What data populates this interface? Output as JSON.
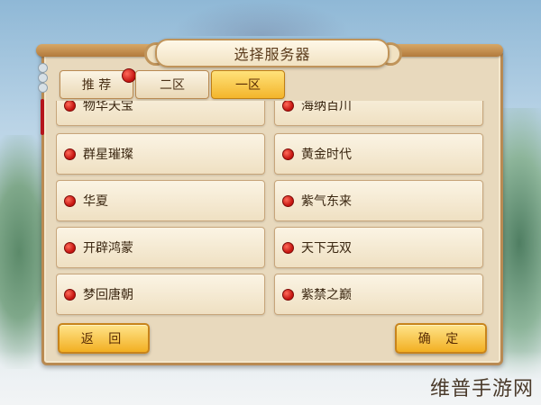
{
  "dialog": {
    "title": "选择服务器"
  },
  "tabs": [
    {
      "label": "推 荐",
      "active": false,
      "has_badge": true
    },
    {
      "label": "二区",
      "active": false
    },
    {
      "label": "一区",
      "active": true
    }
  ],
  "servers": [
    {
      "name": "物华天宝",
      "col": "left"
    },
    {
      "name": "海纳百川",
      "col": "right"
    },
    {
      "name": "群星璀璨",
      "col": "left"
    },
    {
      "name": "黄金时代",
      "col": "right"
    },
    {
      "name": "华夏",
      "col": "left"
    },
    {
      "name": "紫气东来",
      "col": "right"
    },
    {
      "name": "开辟鸿蒙",
      "col": "left"
    },
    {
      "name": "天下无双",
      "col": "right"
    },
    {
      "name": "梦回唐朝",
      "col": "left"
    },
    {
      "name": "紫禁之巅",
      "col": "right"
    }
  ],
  "buttons": {
    "back": "返 回",
    "confirm": "确 定"
  },
  "watermark": "维普手游网",
  "colors": {
    "status_dot": "#c51511",
    "active_tab": "#f3b52b",
    "frame": "#b98a52"
  }
}
